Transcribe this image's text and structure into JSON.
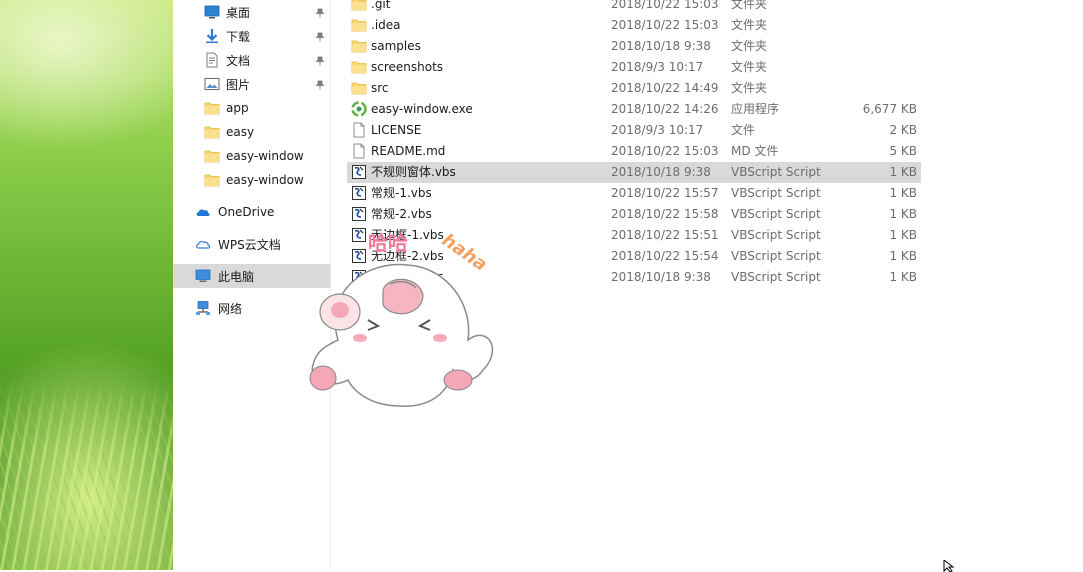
{
  "nav": {
    "items": [
      {
        "label": "桌面",
        "icon": "desktop-icon",
        "pinned": true
      },
      {
        "label": "下载",
        "icon": "download-arrow-icon",
        "pinned": true
      },
      {
        "label": "文档",
        "icon": "document-icon",
        "pinned": true
      },
      {
        "label": "图片",
        "icon": "picture-icon",
        "pinned": true
      },
      {
        "label": "app",
        "icon": "folder-icon",
        "pinned": false
      },
      {
        "label": "easy",
        "icon": "folder-icon",
        "pinned": false
      },
      {
        "label": "easy-window",
        "icon": "folder-icon",
        "pinned": false
      },
      {
        "label": "easy-window",
        "icon": "folder-icon",
        "pinned": false
      },
      {
        "label": "OneDrive",
        "icon": "cloud-icon",
        "pinned": false
      },
      {
        "label": "WPS云文档",
        "icon": "wps-cloud-icon",
        "pinned": false
      },
      {
        "label": "此电脑",
        "icon": "computer-icon",
        "pinned": false,
        "selected": true
      },
      {
        "label": "网络",
        "icon": "network-icon",
        "pinned": false
      }
    ]
  },
  "files": [
    {
      "name": ".git",
      "date": "2018/10/22 15:03",
      "type": "文件夹",
      "size": "",
      "icon": "folder-icon"
    },
    {
      "name": ".idea",
      "date": "2018/10/22 15:03",
      "type": "文件夹",
      "size": "",
      "icon": "folder-icon"
    },
    {
      "name": "samples",
      "date": "2018/10/18 9:38",
      "type": "文件夹",
      "size": "",
      "icon": "folder-icon"
    },
    {
      "name": "screenshots",
      "date": "2018/9/3 10:17",
      "type": "文件夹",
      "size": "",
      "icon": "folder-icon"
    },
    {
      "name": "src",
      "date": "2018/10/22 14:49",
      "type": "文件夹",
      "size": "",
      "icon": "folder-icon"
    },
    {
      "name": "easy-window.exe",
      "date": "2018/10/22 14:26",
      "type": "应用程序",
      "size": "6,677 KB",
      "icon": "exe-icon"
    },
    {
      "name": "LICENSE",
      "date": "2018/9/3 10:17",
      "type": "文件",
      "size": "2 KB",
      "icon": "file-icon"
    },
    {
      "name": "README.md",
      "date": "2018/10/22 15:03",
      "type": "MD 文件",
      "size": "5 KB",
      "icon": "file-icon"
    },
    {
      "name": "不规则窗体.vbs",
      "date": "2018/10/18 9:38",
      "type": "VBScript Script",
      "size": "1 KB",
      "icon": "vbs-icon",
      "selected": true
    },
    {
      "name": "常规-1.vbs",
      "date": "2018/10/22 15:57",
      "type": "VBScript Script",
      "size": "1 KB",
      "icon": "vbs-icon"
    },
    {
      "name": "常规-2.vbs",
      "date": "2018/10/22 15:58",
      "type": "VBScript Script",
      "size": "1 KB",
      "icon": "vbs-icon"
    },
    {
      "name": "无边框-1.vbs",
      "date": "2018/10/22 15:51",
      "type": "VBScript Script",
      "size": "1 KB",
      "icon": "vbs-icon"
    },
    {
      "name": "无边框-2.vbs",
      "date": "2018/10/22 15:54",
      "type": "VBScript Script",
      "size": "1 KB",
      "icon": "vbs-icon"
    },
    {
      "name": "无边框-3.vbs",
      "date": "2018/10/18 9:38",
      "type": "VBScript Script",
      "size": "1 KB",
      "icon": "vbs-icon"
    }
  ],
  "sticker": {
    "text_cn": "哈哈",
    "text_en": "haha"
  },
  "colors": {
    "selection": "#d9d9d9",
    "folder": "#f8d775",
    "muted_text": "#6d6d6d"
  }
}
